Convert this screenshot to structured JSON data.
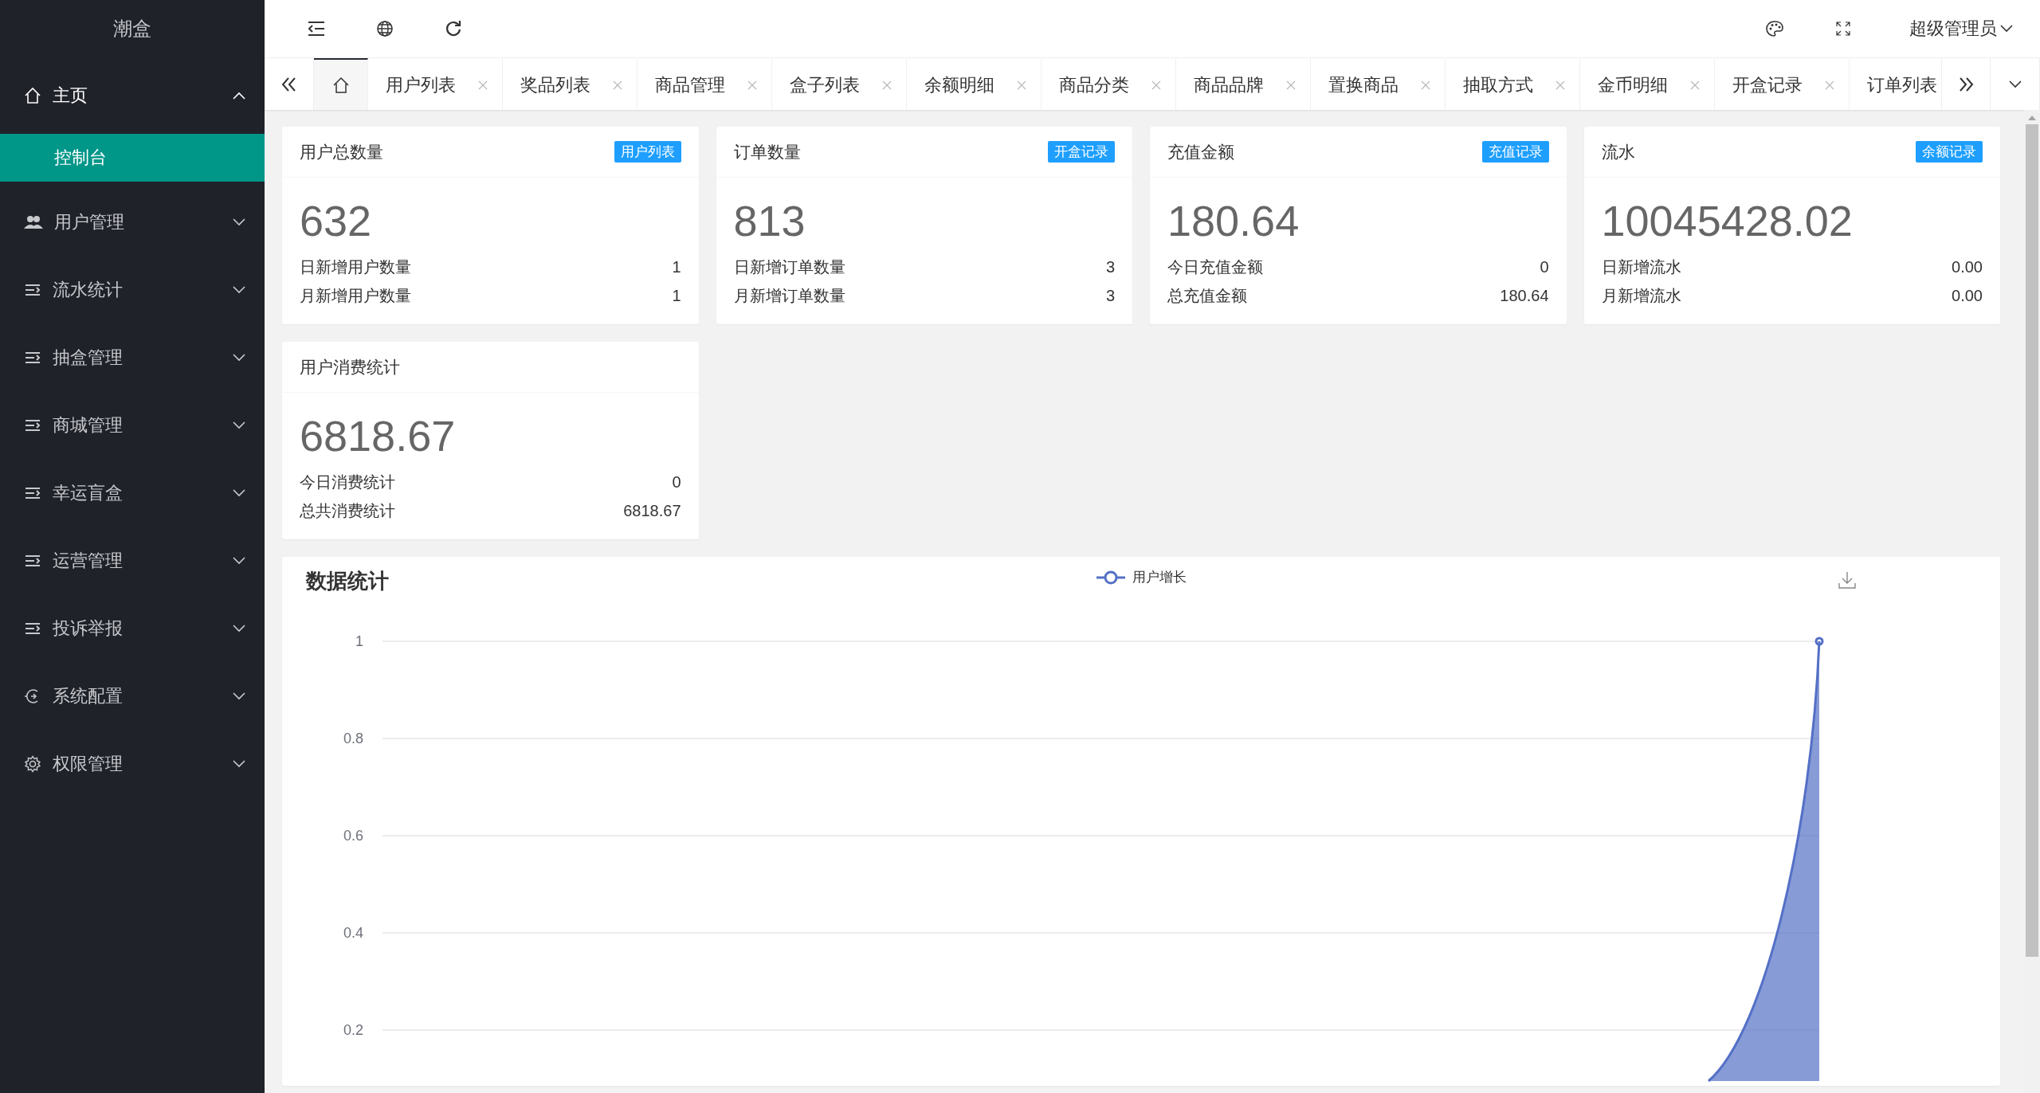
{
  "sidebar": {
    "logo": "潮盒",
    "items": [
      {
        "kind": "home",
        "label": "主页",
        "expanded": true,
        "children": [
          {
            "label": "控制台",
            "selected": true
          }
        ]
      },
      {
        "kind": "users",
        "label": "用户管理",
        "expanded": false
      },
      {
        "kind": "list",
        "label": "流水统计",
        "expanded": false
      },
      {
        "kind": "list",
        "label": "抽盒管理",
        "expanded": false
      },
      {
        "kind": "list",
        "label": "商城管理",
        "expanded": false
      },
      {
        "kind": "list",
        "label": "幸运盲盒",
        "expanded": false
      },
      {
        "kind": "list",
        "label": "运营管理",
        "expanded": false
      },
      {
        "kind": "list",
        "label": "投诉举报",
        "expanded": false
      },
      {
        "kind": "plugin",
        "label": "系统配置",
        "expanded": false
      },
      {
        "kind": "gear",
        "label": "权限管理",
        "expanded": false
      }
    ]
  },
  "header": {
    "user": "超级管理员"
  },
  "tabs": [
    {
      "kind": "home",
      "selected": true
    },
    {
      "kind": "page",
      "label": "用户列表",
      "selected": false
    },
    {
      "kind": "page",
      "label": "奖品列表",
      "selected": false
    },
    {
      "kind": "page",
      "label": "商品管理",
      "selected": false
    },
    {
      "kind": "page",
      "label": "盒子列表",
      "selected": false
    },
    {
      "kind": "page",
      "label": "余额明细",
      "selected": false
    },
    {
      "kind": "page",
      "label": "商品分类",
      "selected": false
    },
    {
      "kind": "page",
      "label": "商品品牌",
      "selected": false
    },
    {
      "kind": "page",
      "label": "置换商品",
      "selected": false
    },
    {
      "kind": "page",
      "label": "抽取方式",
      "selected": false
    },
    {
      "kind": "page",
      "label": "金币明细",
      "selected": false
    },
    {
      "kind": "page",
      "label": "开盒记录",
      "selected": false
    },
    {
      "kind": "page",
      "label": "订单列表",
      "selected": false
    }
  ],
  "cards": [
    {
      "title": "用户总数量",
      "badge": "用户列表",
      "value": "632",
      "rows": [
        {
          "label": "日新增用户数量",
          "value": "1"
        },
        {
          "label": "月新增用户数量",
          "value": "1"
        }
      ]
    },
    {
      "title": "订单数量",
      "badge": "开盒记录",
      "value": "813",
      "rows": [
        {
          "label": "日新增订单数量",
          "value": "3"
        },
        {
          "label": "月新增订单数量",
          "value": "3"
        }
      ]
    },
    {
      "title": "充值金额",
      "badge": "充值记录",
      "value": "180.64",
      "rows": [
        {
          "label": "今日充值金额",
          "value": "0"
        },
        {
          "label": "总充值金额",
          "value": "180.64"
        }
      ]
    },
    {
      "title": "流水",
      "badge": "余额记录",
      "value": "10045428.02",
      "rows": [
        {
          "label": "日新增流水",
          "value": "0.00"
        },
        {
          "label": "月新增流水",
          "value": "0.00"
        }
      ]
    },
    {
      "title": "用户消费统计",
      "value": "6818.67",
      "rows": [
        {
          "label": "今日消费统计",
          "value": "0"
        },
        {
          "label": "总共消费统计",
          "value": "6818.67"
        }
      ]
    }
  ],
  "stats": {
    "title": "数据统计",
    "legend": "用户增长",
    "y_axis_labels": [
      "1",
      "0.8",
      "0.6",
      "0.4",
      "0.2"
    ]
  }
}
